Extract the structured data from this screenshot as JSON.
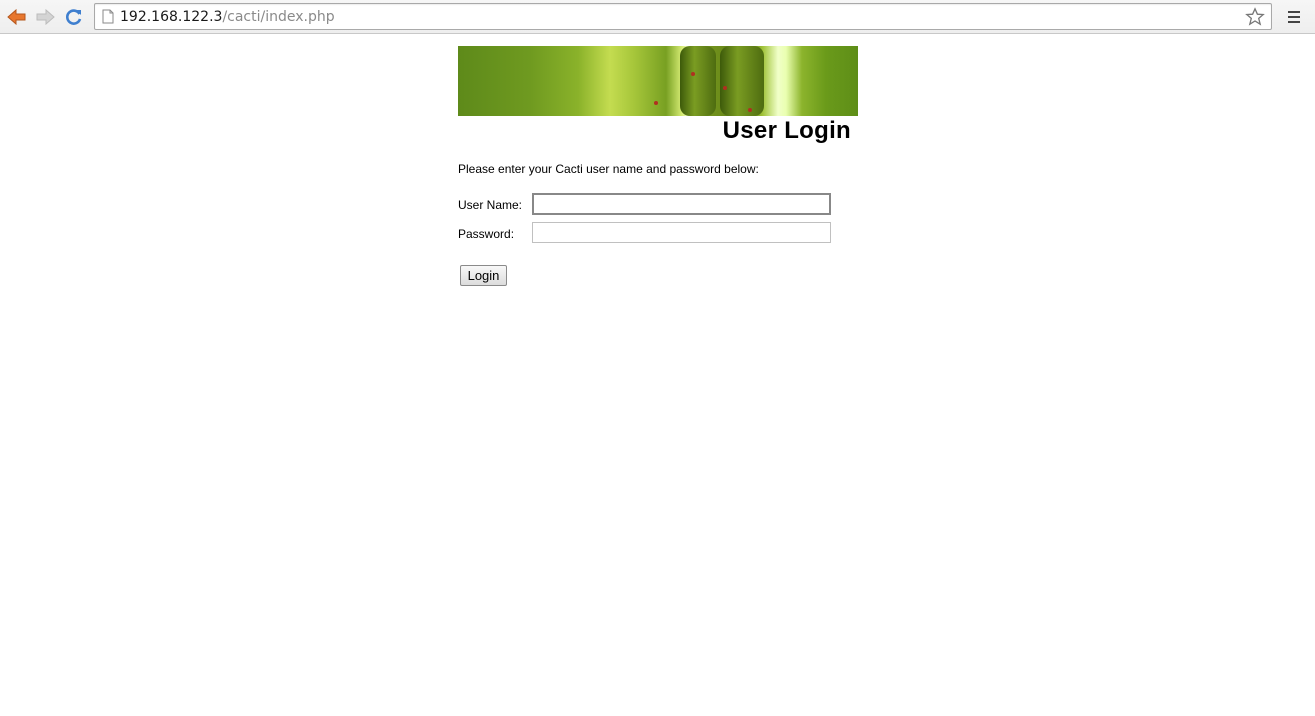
{
  "browser": {
    "url_host": "192.168.122.3",
    "url_path": "/cacti/index.php",
    "icons": {
      "back": "back-arrow-icon",
      "forward": "forward-arrow-icon",
      "reload": "reload-icon",
      "page": "page-icon",
      "bookmark": "star-icon",
      "menu": "hamburger-menu-icon"
    }
  },
  "login": {
    "title": "User Login",
    "instructions": "Please enter your Cacti user name and password below:",
    "username_label": "User Name:",
    "username_value": "",
    "password_label": "Password:",
    "password_value": "",
    "submit_label": "Login"
  },
  "colors": {
    "accent_back_arrow": "#e8772e",
    "reload_blue": "#3f7fcf",
    "banner_green": "#6f9a20"
  }
}
